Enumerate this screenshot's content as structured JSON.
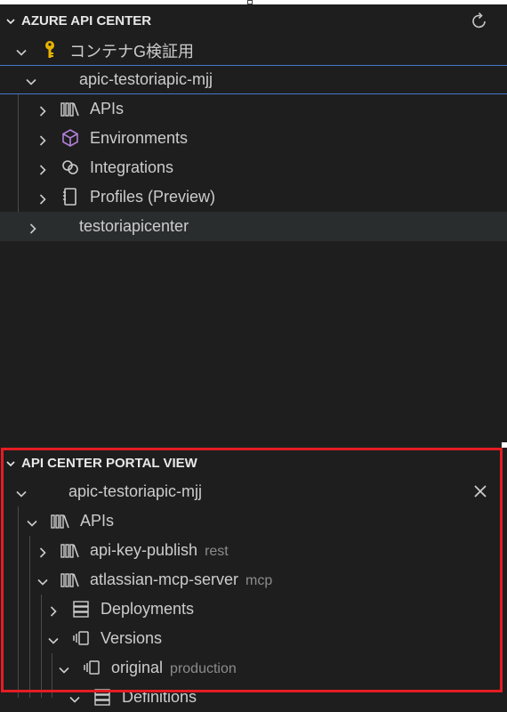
{
  "top_section": {
    "title": "AZURE API CENTER",
    "refresh_icon": "refresh-icon",
    "subscription": {
      "label": "コンテナG検証用",
      "icon": "key-icon"
    },
    "service": {
      "label": "apic-testoriapic-mjj"
    },
    "children": [
      {
        "label": "APIs",
        "icon": "library-icon"
      },
      {
        "label": "Environments",
        "icon": "cube-icon"
      },
      {
        "label": "Integrations",
        "icon": "link-icon"
      },
      {
        "label": "Profiles (Preview)",
        "icon": "notebook-icon"
      }
    ],
    "second_service": {
      "label": "testoriapicenter"
    }
  },
  "portal_section": {
    "title": "API CENTER PORTAL VIEW",
    "service": {
      "label": "apic-testoriapic-mjj",
      "close_icon": "close-icon"
    },
    "apis": {
      "label": "APIs",
      "icon": "library-icon"
    },
    "items": [
      {
        "label": "api-key-publish",
        "desc": "rest",
        "icon": "library-icon"
      },
      {
        "label": "atlassian-mcp-server",
        "desc": "mcp",
        "icon": "library-icon"
      }
    ],
    "deployments": {
      "label": "Deployments",
      "icon": "server-icon"
    },
    "versions": {
      "label": "Versions",
      "icon": "versions-icon"
    },
    "original": {
      "label": "original",
      "desc": "production",
      "icon": "versions-icon"
    },
    "definitions": {
      "label": "Definitions",
      "icon": "server-icon"
    }
  },
  "colors": {
    "background": "#1e1e1e",
    "text": "#cccccc",
    "focus_border": "#3f79c8",
    "highlight_border": "#e51c23",
    "key": "#e8b400",
    "cube": "#b180d7"
  }
}
